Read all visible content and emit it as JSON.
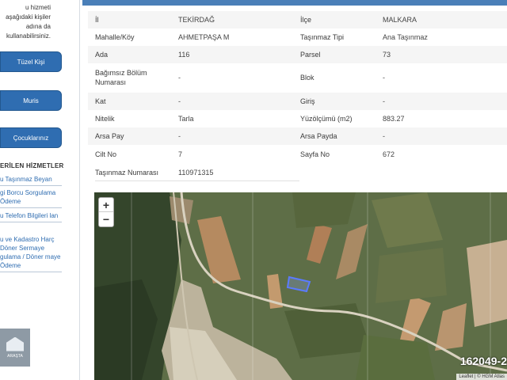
{
  "sidebar": {
    "intro": "u hizmeti aşağıdaki kişiler adına da kullanabilirsiniz.",
    "buttons": [
      "Tüzel Kişi",
      "Muris",
      "Çocuklarınız"
    ],
    "section_title": "ERİLEN HİZMETLER",
    "links": [
      "u Taşınmaz Beyan",
      "gi Borcu Sorgulama Ödeme",
      "u Telefon Bilgileri lan",
      "u ve Kadastro Harç Döner Sermaye gulama / Döner maye Ödeme"
    ],
    "logo_text": "ARAŞTA"
  },
  "info": {
    "rows": [
      {
        "l1": "İl",
        "v1": "TEKİRDAĞ",
        "l2": "İlçe",
        "v2": "MALKARA"
      },
      {
        "l1": "Mahalle/Köy",
        "v1": "AHMETPAŞA M",
        "l2": "Taşınmaz Tipi",
        "v2": "Ana Taşınmaz"
      },
      {
        "l1": "Ada",
        "v1": "116",
        "l2": "Parsel",
        "v2": "73"
      },
      {
        "l1": "Bağımsız Bölüm Numarası",
        "v1": "-",
        "l2": "Blok",
        "v2": "-"
      },
      {
        "l1": "Kat",
        "v1": "-",
        "l2": "Giriş",
        "v2": "-"
      },
      {
        "l1": "Nitelik",
        "v1": "Tarla",
        "l2": "Yüzölçümü (m2)",
        "v2": "883.27"
      },
      {
        "l1": "Arsa Pay",
        "v1": "-",
        "l2": "Arsa Payda",
        "v2": "-"
      },
      {
        "l1": "Cilt No",
        "v1": "7",
        "l2": "Sayfa No",
        "v2": "672"
      },
      {
        "l1": "Taşınmaz Numarası",
        "v1": "110971315"
      }
    ]
  },
  "map": {
    "zoom_in": "+",
    "zoom_out": "−",
    "listing_id": "162049-2",
    "attribution": "Leaflet | © HGM Atlas",
    "road_label": "..."
  }
}
